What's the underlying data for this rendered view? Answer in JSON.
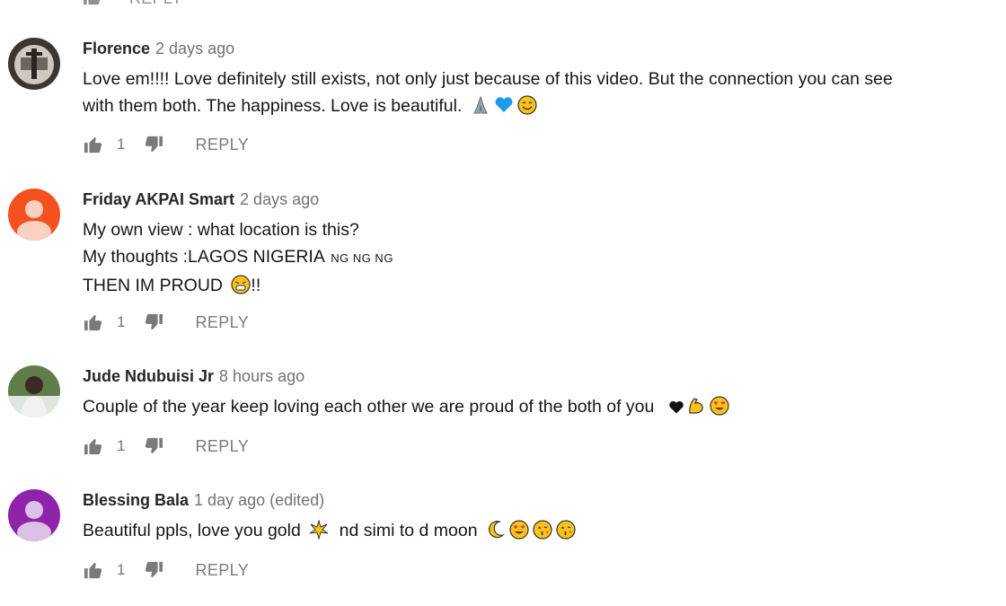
{
  "top": {
    "reply_label": "REPLY"
  },
  "comments": [
    {
      "author": "Florence",
      "time": "2 days ago",
      "lines": [
        "Love em!!!! Love definitely still exists, not only just because of this video. But the connection you can see",
        "with them both. The happiness. Love is beautiful."
      ],
      "likes": "1",
      "reply_label": "REPLY",
      "avatar_color": "#7c756f"
    },
    {
      "author": "Friday AKPAI Smart",
      "time": "2 days ago",
      "lines": [
        "My own view : what location is this?",
        "My thoughts :LAGOS NIGERIA",
        "THEN IM PROUD"
      ],
      "flags": "NG NG NG",
      "exclaim": "!!",
      "likes": "1",
      "reply_label": "REPLY",
      "avatar_color": "#f4511e"
    },
    {
      "author": "Jude Ndubuisi Jr",
      "time": "8 hours ago",
      "lines": [
        "Couple of the year keep loving each other we are proud of the both of you"
      ],
      "likes": "1",
      "reply_label": "REPLY",
      "avatar_color": "#4a6b3a"
    },
    {
      "author": "Blessing Bala",
      "time": "1 day ago (edited)",
      "lines": [
        "Beautiful ppls, love you gold",
        "nd simi to d moon"
      ],
      "likes": "1",
      "reply_label": "REPLY",
      "avatar_color": "#8e24aa"
    }
  ]
}
